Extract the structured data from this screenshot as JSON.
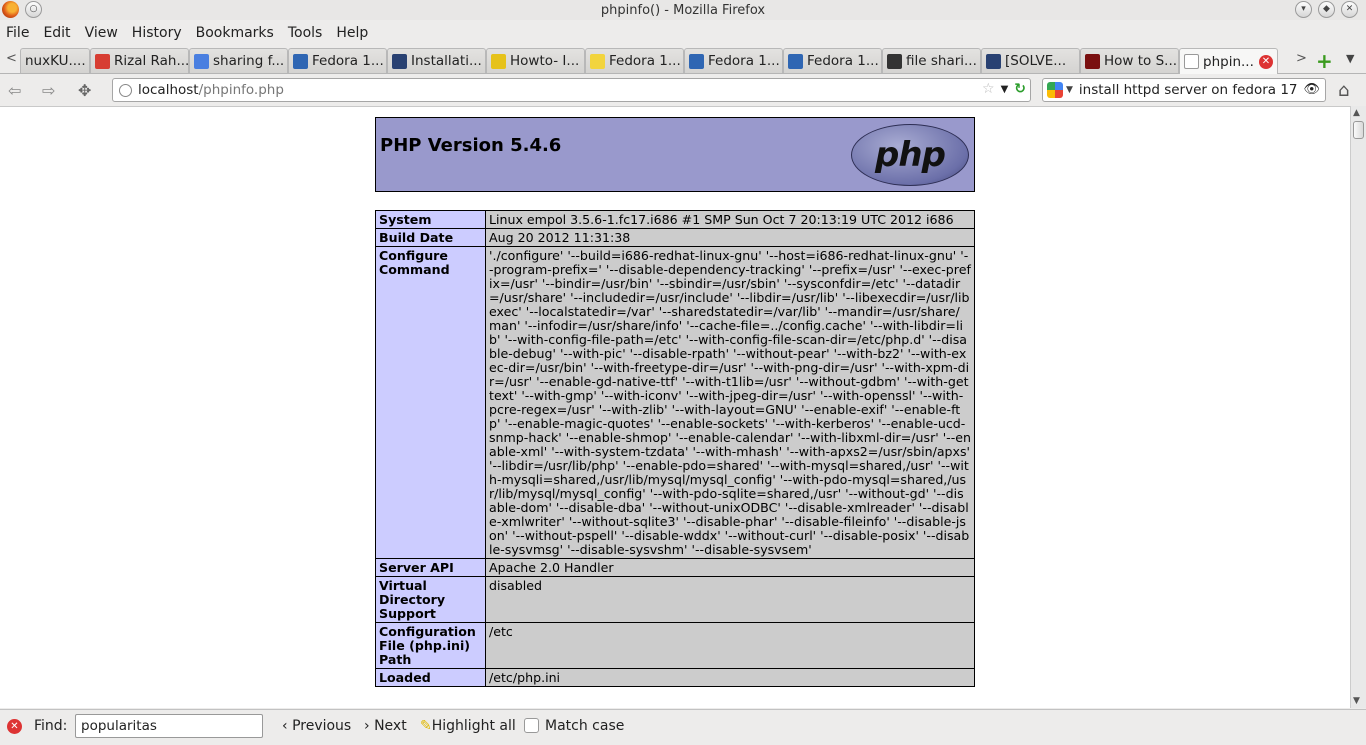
{
  "window": {
    "title": "phpinfo() - Mozilla Firefox"
  },
  "menu": [
    "File",
    "Edit",
    "View",
    "History",
    "Bookmarks",
    "Tools",
    "Help"
  ],
  "tabs": [
    {
      "label": "nuxKU....",
      "color": "#3a6ea5",
      "glyph": ""
    },
    {
      "label": "Rizal Rah...",
      "color": "#d73d32",
      "glyph": "g+"
    },
    {
      "label": "sharing f...",
      "color": "#4a7fe0",
      "glyph": "g"
    },
    {
      "label": "Fedora 1...",
      "color": "#2f66b3",
      "glyph": "e"
    },
    {
      "label": "Installati...",
      "color": "#294172",
      "glyph": "f"
    },
    {
      "label": "Howto- I...",
      "color": "#e6c21a",
      "glyph": ""
    },
    {
      "label": "Fedora 1...",
      "color": "#f2d43d",
      "glyph": ""
    },
    {
      "label": "Fedora 1...",
      "color": "#2f66b3",
      "glyph": "e"
    },
    {
      "label": "Fedora 1...",
      "color": "#2f66b3",
      "glyph": "e"
    },
    {
      "label": "file shari...",
      "color": "#333333",
      "glyph": ""
    },
    {
      "label": "[SOLVE...",
      "color": "#294172",
      "glyph": "f"
    },
    {
      "label": "How to S...",
      "color": "#7a1010",
      "glyph": ""
    },
    {
      "label": "phpin...",
      "color": "#ffffff",
      "glyph": "",
      "active": true
    }
  ],
  "nav": {
    "url_host": "localhost",
    "url_path": "/phpinfo.php",
    "search_value": "install httpd server on fedora 17"
  },
  "page": {
    "heading": "PHP Version 5.4.6",
    "logo_text": "php",
    "rows": [
      {
        "key": "System",
        "value": "Linux empol 3.5.6-1.fc17.i686 #1 SMP Sun Oct 7 20:13:19 UTC 2012 i686"
      },
      {
        "key": "Build Date",
        "value": "Aug 20 2012 11:31:38"
      },
      {
        "key": "Configure Command",
        "value": "'./configure' '--build=i686-redhat-linux-gnu' '--host=i686-redhat-linux-gnu' '--program-prefix=' '--disable-dependency-tracking' '--prefix=/usr' '--exec-prefix=/usr' '--bindir=/usr/bin' '--sbindir=/usr/sbin' '--sysconfdir=/etc' '--datadir=/usr/share' '--includedir=/usr/include' '--libdir=/usr/lib' '--libexecdir=/usr/libexec' '--localstatedir=/var' '--sharedstatedir=/var/lib' '--mandir=/usr/share/man' '--infodir=/usr/share/info' '--cache-file=../config.cache' '--with-libdir=lib' '--with-config-file-path=/etc' '--with-config-file-scan-dir=/etc/php.d' '--disable-debug' '--with-pic' '--disable-rpath' '--without-pear' '--with-bz2' '--with-exec-dir=/usr/bin' '--with-freetype-dir=/usr' '--with-png-dir=/usr' '--with-xpm-dir=/usr' '--enable-gd-native-ttf' '--with-t1lib=/usr' '--without-gdbm' '--with-gettext' '--with-gmp' '--with-iconv' '--with-jpeg-dir=/usr' '--with-openssl' '--with-pcre-regex=/usr' '--with-zlib' '--with-layout=GNU' '--enable-exif' '--enable-ftp' '--enable-magic-quotes' '--enable-sockets' '--with-kerberos' '--enable-ucd-snmp-hack' '--enable-shmop' '--enable-calendar' '--with-libxml-dir=/usr' '--enable-xml' '--with-system-tzdata' '--with-mhash' '--with-apxs2=/usr/sbin/apxs' '--libdir=/usr/lib/php' '--enable-pdo=shared' '--with-mysql=shared,/usr' '--with-mysqli=shared,/usr/lib/mysql/mysql_config' '--with-pdo-mysql=shared,/usr/lib/mysql/mysql_config' '--with-pdo-sqlite=shared,/usr' '--without-gd' '--disable-dom' '--disable-dba' '--without-unixODBC' '--disable-xmlreader' '--disable-xmlwriter' '--without-sqlite3' '--disable-phar' '--disable-fileinfo' '--disable-json' '--without-pspell' '--disable-wddx' '--without-curl' '--disable-posix' '--disable-sysvmsg' '--disable-sysvshm' '--disable-sysvsem'"
      },
      {
        "key": "Server API",
        "value": "Apache 2.0 Handler"
      },
      {
        "key": "Virtual Directory Support",
        "value": "disabled"
      },
      {
        "key": "Configuration File (php.ini) Path",
        "value": "/etc"
      },
      {
        "key": "Loaded",
        "value": "/etc/php.ini"
      }
    ]
  },
  "find": {
    "label": "Find:",
    "value": "popularitas",
    "previous": "Previous",
    "next": "Next",
    "highlight": "Highlight all",
    "match_case": "Match case"
  }
}
